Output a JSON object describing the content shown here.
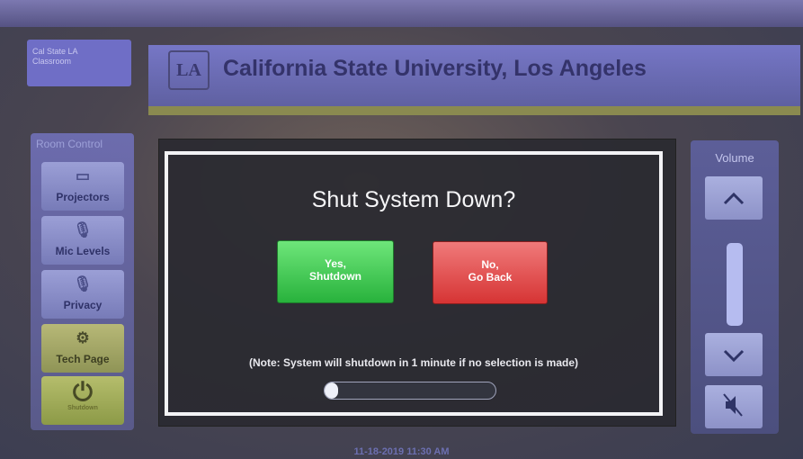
{
  "header": {
    "title": "California State University, Los Angeles",
    "logo_text": "LA",
    "left_logo_text": "Cal State LA\nClassroom"
  },
  "left_panel": {
    "heading": "Room Control",
    "items": [
      {
        "label": "Projectors",
        "icon": "projector-icon"
      },
      {
        "label": "Mic Levels",
        "icon": "microphone-icon"
      },
      {
        "label": "Privacy",
        "icon": "mic-mute-icon"
      },
      {
        "label": "Tech Page",
        "icon": "gear-icon"
      },
      {
        "label": "Shutdown",
        "icon": "power-icon"
      }
    ]
  },
  "volume": {
    "label": "Volume",
    "up_icon": "chevron-up-icon",
    "down_icon": "chevron-down-icon",
    "mute_icon": "speaker-mute-icon",
    "level": 0.5
  },
  "dialog": {
    "title": "Shut System Down?",
    "yes_line1": "Yes,",
    "yes_line2": "Shutdown",
    "no_line1": "No,",
    "no_line2": "Go Back",
    "note": "(Note: System will shutdown in 1 minute if no selection is made)",
    "progress": 0.08
  },
  "status": {
    "datetime": "11-18-2019 11:30 AM"
  },
  "colors": {
    "yes": "#2fb540",
    "no": "#d63434",
    "header": "#6a6cc0"
  }
}
